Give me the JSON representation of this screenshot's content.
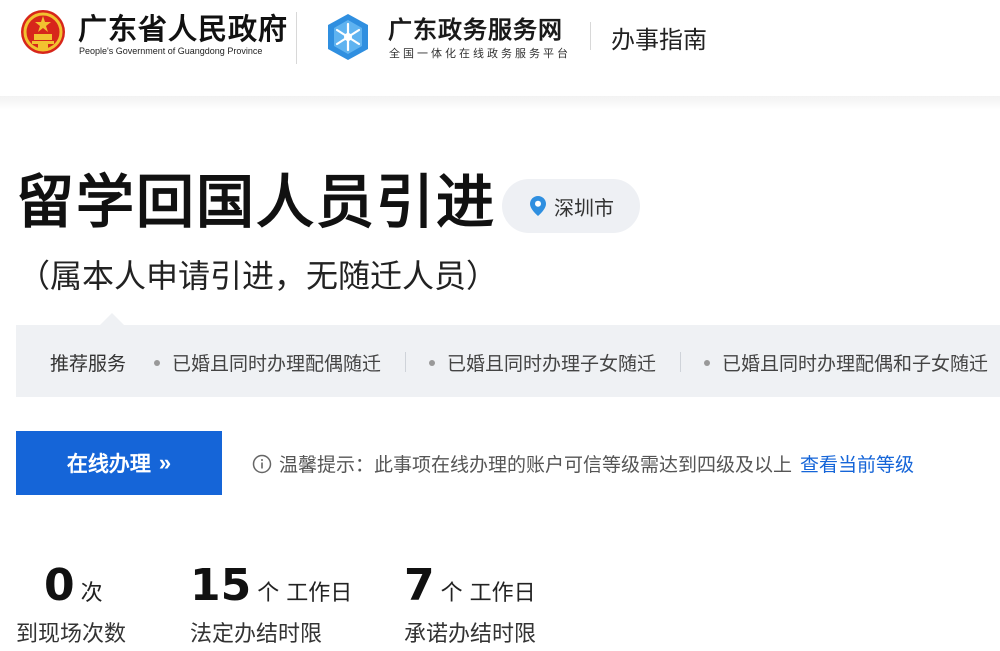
{
  "header": {
    "gov_title": "广东省人民政府",
    "gov_subtitle": "People's Government of Guangdong Province",
    "portal_title": "广东政务服务网",
    "portal_subtitle": "全国一体化在线政务服务平台",
    "section_title": "办事指南"
  },
  "main": {
    "title": "留学回国人员引进",
    "subtitle": "（属本人申请引进，无随迁人员）",
    "location": "深圳市"
  },
  "recommend": {
    "label": "推荐服务",
    "items": [
      "已婚且同时办理配偶随迁",
      "已婚且同时办理子女随迁",
      "已婚且同时办理配偶和子女随迁"
    ]
  },
  "action": {
    "online_button": "在线办理",
    "tip_text": "温馨提示：此事项在线办理的账户可信等级需达到四级及以上",
    "tip_link": "查看当前等级"
  },
  "stats": [
    {
      "value": "0",
      "unit": "次",
      "label": "到现场次数"
    },
    {
      "value": "15",
      "unit": "个 工作日",
      "label": "法定办结时限"
    },
    {
      "value": "7",
      "unit": "个 工作日",
      "label": "承诺办结时限"
    }
  ],
  "colors": {
    "primary": "#1565d8",
    "emblem_red": "#d7261b",
    "emblem_gold": "#f2c230",
    "logo_blue": "#2f8fe0",
    "bar_bg": "#eff1f4"
  },
  "icons": {
    "emblem": "national-emblem-icon",
    "portal_logo": "guangdong-portal-logo-icon",
    "location": "location-pin-icon",
    "tip": "info-icon"
  }
}
